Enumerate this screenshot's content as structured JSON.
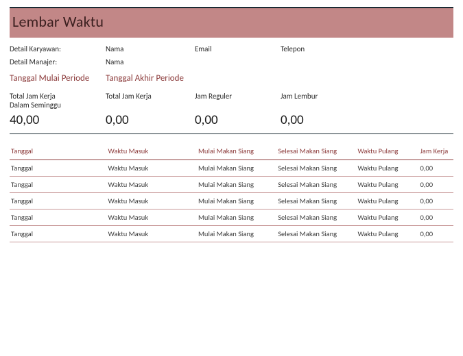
{
  "title": "Lembar Waktu",
  "details": {
    "employee_label": "Detail Karyawan:",
    "manager_label": "Detail Manajer:",
    "name_label": "Nama",
    "email_label": "Email",
    "phone_label": "Telepon"
  },
  "period": {
    "start_label": "Tanggal Mulai Periode",
    "end_label": "Tanggal Akhir Periode"
  },
  "summary": {
    "total_week_label_line1": "Total Jam Kerja",
    "total_week_label_line2": "Dalam Seminggu",
    "total_hours_label": "Total Jam Kerja",
    "regular_hours_label": "Jam Reguler",
    "overtime_hours_label": "Jam Lembur",
    "total_week_value": "40,00",
    "total_hours_value": "0,00",
    "regular_hours_value": "0,00",
    "overtime_hours_value": "0,00"
  },
  "table": {
    "headers": {
      "date": "Tanggal",
      "time_in": "Waktu Masuk",
      "lunch_start": "Mulai Makan Siang",
      "lunch_end": "Selesai Makan Siang",
      "time_out": "Waktu Pulang",
      "hours": "Jam Kerja"
    },
    "rows": [
      {
        "date": "Tanggal",
        "time_in": "Waktu Masuk",
        "lunch_start": "Mulai Makan Siang",
        "lunch_end": "Selesai Makan Siang",
        "time_out": "Waktu Pulang",
        "hours": "0,00"
      },
      {
        "date": "Tanggal",
        "time_in": "Waktu Masuk",
        "lunch_start": "Mulai Makan Siang",
        "lunch_end": "Selesai Makan Siang",
        "time_out": "Waktu Pulang",
        "hours": "0,00"
      },
      {
        "date": "Tanggal",
        "time_in": "Waktu Masuk",
        "lunch_start": "Mulai Makan Siang",
        "lunch_end": "Selesai Makan Siang",
        "time_out": "Waktu Pulang",
        "hours": "0,00"
      },
      {
        "date": "Tanggal",
        "time_in": "Waktu Masuk",
        "lunch_start": "Mulai Makan Siang",
        "lunch_end": "Selesai Makan Siang",
        "time_out": "Waktu Pulang",
        "hours": "0,00"
      },
      {
        "date": "Tanggal",
        "time_in": "Waktu Masuk",
        "lunch_start": "Mulai Makan Siang",
        "lunch_end": "Selesai Makan Siang",
        "time_out": "Waktu Pulang",
        "hours": "0,00"
      }
    ]
  }
}
